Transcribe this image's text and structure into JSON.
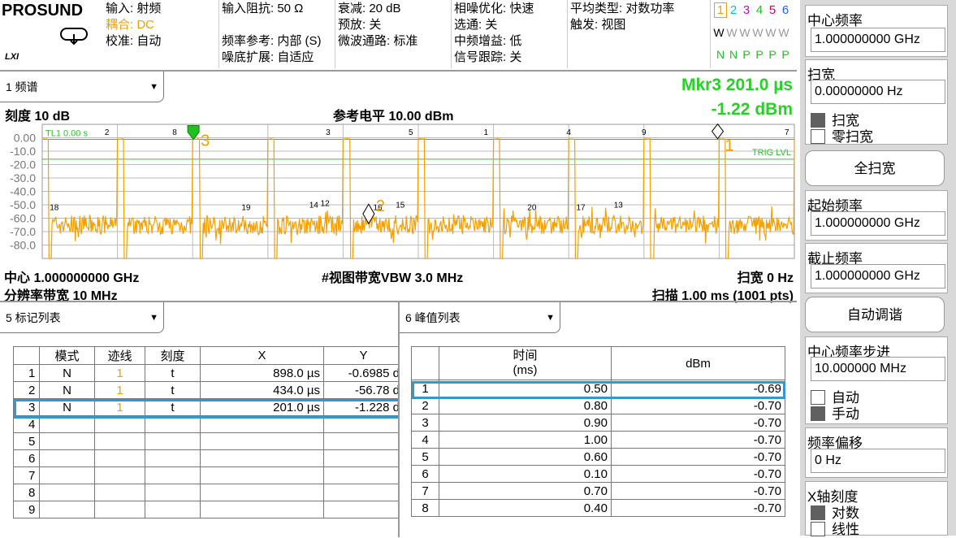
{
  "header": {
    "brand": "PROSUND",
    "lxi": "LXI",
    "input": "输入: 射频",
    "coupling": "耦合: DC",
    "align": "校准: 自动",
    "impedance": "输入阻抗: 50 Ω",
    "freq_ref": "频率参考: 内部 (S)",
    "noise_ext": "噪底扩展: 自适应",
    "atten": "衰减: 20 dB",
    "preamp": "预放: 关",
    "mw_path": "微波通路: 标准",
    "phase_noise": "相噪优化: 快速",
    "gate": "选通: 关",
    "if_gain": "中频增益: 低",
    "sig_track": "信号跟踪: 关",
    "avg_type": "平均类型: 对数功率",
    "trigger": "触发: 视图",
    "trace_nums": [
      "1",
      "2",
      "3",
      "4",
      "5",
      "6"
    ],
    "trace_colors": [
      "#f5a000",
      "#00c0e0",
      "#d000d0",
      "#20c020",
      "#e00050",
      "#2060ff"
    ],
    "trace_types": [
      "W",
      "W",
      "W",
      "W",
      "W",
      "W"
    ],
    "trace_dets": [
      "N",
      "N",
      "P",
      "P",
      "P",
      "P"
    ]
  },
  "spectrum": {
    "selector": "1 频谱",
    "mkr_label": "Mkr3  201.0 µs",
    "mkr_value": "-1.22 dBm",
    "scale": "刻度 10 dB",
    "ref_level": "参考电平 10.00 dBm",
    "tl_label": "TL1 0.00 s",
    "trig_lvl": "TRIG LVL",
    "y_ticks": [
      "0.00",
      "-10.0",
      "-20.0",
      "-30.0",
      "-40.0",
      "-50.0",
      "-60.0",
      "-70.0",
      "-80.0"
    ],
    "center": "中心 1.000000000 GHz",
    "rbw": "分辨率带宽 10 MHz",
    "vbw": "#视图带宽VBW 3.0 MHz",
    "span": "扫宽 0 Hz",
    "sweep": "扫描 1.00 ms (1001 pts)",
    "peak_labels": [
      "2",
      "8",
      "3",
      "5",
      "1",
      "4",
      "9",
      "7"
    ],
    "low_labels": [
      "18",
      "19",
      "14",
      "12",
      "16",
      "15",
      "20",
      "17",
      "13"
    ],
    "marker_nums": [
      "3",
      "2",
      "1"
    ],
    "accent": "#f5a000"
  },
  "chart_data": {
    "type": "line",
    "title": "",
    "xlabel": "",
    "ylabel": "",
    "ylim": [
      -90,
      10
    ],
    "xlim": [
      0,
      1.0
    ],
    "x_unit": "ms",
    "y_unit": "dBm",
    "reference_lines": [
      {
        "name": "TRIG LVL",
        "y": -16
      },
      {
        "name": "TL",
        "y": 0
      }
    ],
    "series": [
      {
        "name": "",
        "pulse_starts_ms": [
          0.0,
          0.1,
          0.2,
          0.3,
          0.4,
          0.5,
          0.6,
          0.7,
          0.8,
          0.9,
          1.0
        ],
        "pulse_width_ms": 0.003,
        "pulse_peak_dbm": -0.7,
        "noise_floor_dbm": -65
      }
    ],
    "markers": [
      {
        "id": "1",
        "x_us": 898.0,
        "y_dbm": -0.6985
      },
      {
        "id": "2",
        "x_us": 434.0,
        "y_dbm": -56.78
      },
      {
        "id": "3",
        "x_us": 201.0,
        "y_dbm": -1.228
      }
    ]
  },
  "marker_table": {
    "selector": "5 标记列表",
    "headers": [
      "模式",
      "迹线",
      "刻度",
      "X",
      "Y"
    ],
    "rows": [
      {
        "n": "1",
        "mode": "N",
        "trace": "1",
        "scale": "t",
        "x": "898.0 µs",
        "y": "-0.6985 d"
      },
      {
        "n": "2",
        "mode": "N",
        "trace": "1",
        "scale": "t",
        "x": "434.0 µs",
        "y": "-56.78 d"
      },
      {
        "n": "3",
        "mode": "N",
        "trace": "1",
        "scale": "t",
        "x": "201.0 µs",
        "y": "-1.228 d"
      },
      {
        "n": "4",
        "mode": "",
        "trace": "",
        "scale": "",
        "x": "",
        "y": ""
      },
      {
        "n": "5",
        "mode": "",
        "trace": "",
        "scale": "",
        "x": "",
        "y": ""
      },
      {
        "n": "6",
        "mode": "",
        "trace": "",
        "scale": "",
        "x": "",
        "y": ""
      },
      {
        "n": "7",
        "mode": "",
        "trace": "",
        "scale": "",
        "x": "",
        "y": ""
      },
      {
        "n": "8",
        "mode": "",
        "trace": "",
        "scale": "",
        "x": "",
        "y": ""
      },
      {
        "n": "9",
        "mode": "",
        "trace": "",
        "scale": "",
        "x": "",
        "y": ""
      }
    ]
  },
  "peak_table": {
    "selector": "6 峰值列表",
    "headers": [
      "时间\n(ms)",
      "dBm"
    ],
    "rows": [
      {
        "n": "1",
        "t": "0.50",
        "v": "-0.69"
      },
      {
        "n": "2",
        "t": "0.80",
        "v": "-0.70"
      },
      {
        "n": "3",
        "t": "0.90",
        "v": "-0.70"
      },
      {
        "n": "4",
        "t": "1.00",
        "v": "-0.70"
      },
      {
        "n": "5",
        "t": "0.60",
        "v": "-0.70"
      },
      {
        "n": "6",
        "t": "0.10",
        "v": "-0.70"
      },
      {
        "n": "7",
        "t": "0.70",
        "v": "-0.70"
      },
      {
        "n": "8",
        "t": "0.40",
        "v": "-0.70"
      }
    ]
  },
  "softkeys": {
    "center_freq_label": "中心频率",
    "center_freq_value": "1.000000000 GHz",
    "span_label": "扫宽",
    "span_value": "0.00000000 Hz",
    "span_opt": "扫宽",
    "zero_span_opt": "零扫宽",
    "full_span": "全扫宽",
    "start_label": "起始频率",
    "start_value": "1.000000000 GHz",
    "stop_label": "截止频率",
    "stop_value": "1.000000000 GHz",
    "auto_tune": "自动调谐",
    "cf_step_label": "中心频率步进",
    "cf_step_value": "10.000000 MHz",
    "auto": "自动",
    "manual": "手动",
    "offset_label": "频率偏移",
    "offset_value": "0 Hz",
    "x_scale_label": "X轴刻度",
    "log": "对数",
    "linear": "线性"
  }
}
